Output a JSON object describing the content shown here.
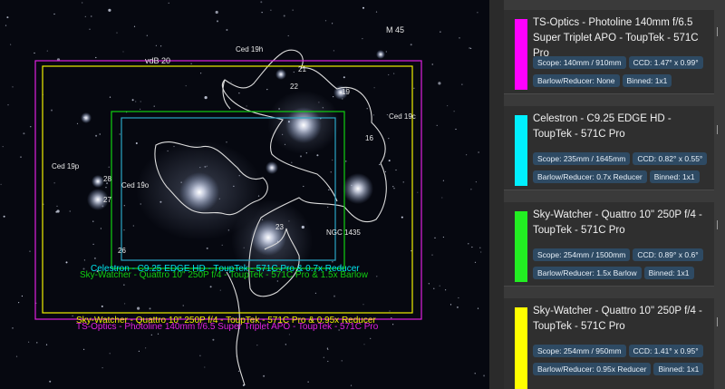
{
  "sky_chart": {
    "object_labels": {
      "m45": "M 45",
      "ced19h": "Ced 19h",
      "vdb20": "vdB 20",
      "ced19c": "Ced 19c",
      "ced19p": "Ced 19p",
      "ced19o": "Ced 19o",
      "ngc1435": "NGC 1435",
      "s21": "21",
      "s22": "22",
      "s19": "19",
      "s16": "16",
      "s28": "28",
      "s27": "27",
      "s23": "23",
      "s26": "26"
    },
    "fov_labels": {
      "celestron": "Celestron - C9.25 EDGE HD - TоupTek - 571C Pro  & 0.7x Reducer",
      "quattro_15x": "Sky-Watcher - Quattro 10\" 250P f/4 - ToupTek - 571C Pro  & 1.5x Barlow",
      "quattro_095x": "Sky-Watcher - Quattro 10\" 250P f/4 - ToupTek - 571C Pro  & 0.95x Reducer",
      "tsoptics": "TS-Optics - Photoline 140mm f/6.5 Super Triplet APO - ToupTek - 571C Pro"
    },
    "colors": {
      "magenta": "#e020e0",
      "cyan": "#00e5ee",
      "green": "#10d010",
      "yellow": "#f0f000",
      "teal": "#2aa6c6"
    }
  },
  "cards": [
    {
      "title": "TS-Optics - Photoline 140mm f/6.5 Super Triplet APO - ToupTek - 571C Pro",
      "color": "#ff00ff",
      "scope": "Scope: 140mm / 910mm",
      "ccd": "CCD: 1.47° x 0.99°",
      "barlow": "Barlow/Reducer: None",
      "binned": "Binned: 1x1"
    },
    {
      "title": "Celestron - C9.25 EDGE HD - ToupTek - 571C Pro",
      "color": "#00f0ff",
      "scope": "Scope: 235mm / 1645mm",
      "ccd": "CCD: 0.82° x 0.55°",
      "barlow": "Barlow/Reducer: 0.7x Reducer",
      "binned": "Binned: 1x1"
    },
    {
      "title": "Sky-Watcher - Quattro 10\" 250P f/4 - ToupTek - 571C Pro",
      "color": "#22ee22",
      "scope": "Scope: 254mm / 1500mm",
      "ccd": "CCD: 0.89° x 0.6°",
      "barlow": "Barlow/Reducer: 1.5x Barlow",
      "binned": "Binned: 1x1"
    },
    {
      "title": "Sky-Watcher - Quattro 10\" 250P f/4 - ToupTek - 571C Pro",
      "color": "#ffff00",
      "scope": "Scope: 254mm / 950mm",
      "ccd": "CCD: 1.41° x 0.95°",
      "barlow": "Barlow/Reducer: 0.95x Reducer",
      "binned": "Binned: 1x1"
    }
  ]
}
